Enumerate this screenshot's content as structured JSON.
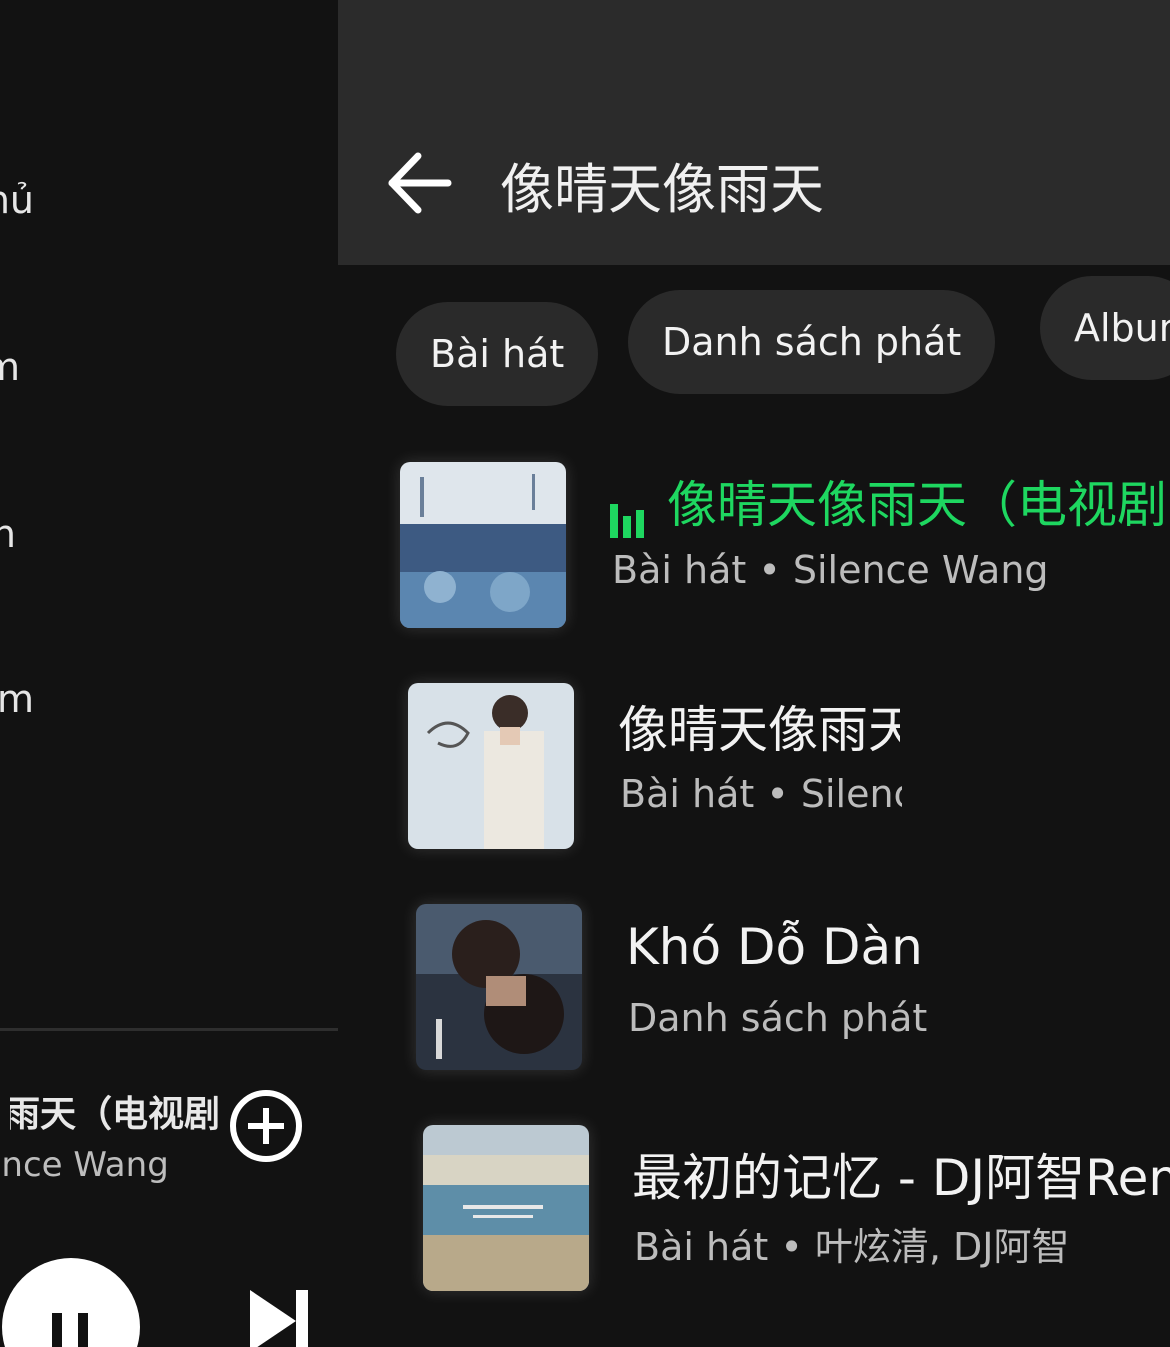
{
  "sidebar": {
    "items": [
      {
        "label": "Trang chủ"
      },
      {
        "label": "Tìm kiếm"
      },
      {
        "label": "Thư viện"
      },
      {
        "label": "Premium"
      }
    ]
  },
  "now_playing": {
    "title": "像晴天像雨天（电视剧《",
    "artist": "Silence Wang"
  },
  "search": {
    "query": "像晴天像雨天"
  },
  "filters": [
    "Bài hát",
    "Danh sách phát",
    "Album"
  ],
  "results": [
    {
      "title": "像晴天像雨天（电视剧",
      "subtitle": "Bài hát • Silence Wang",
      "playing": true
    },
    {
      "title": "像晴天像雨天",
      "subtitle": "Bài hát • Silence Wang",
      "playing": false
    },
    {
      "title": "Khó Dỗ Dàn",
      "subtitle": "Danh sách phát",
      "playing": false
    },
    {
      "title": "最初的记忆 - DJ阿智Remix",
      "subtitle": "Bài hát • 叶炫清, DJ阿智",
      "playing": false
    }
  ],
  "colors": {
    "accent": "#1ed760",
    "background": "#121212",
    "header": "#2b2b2b",
    "chip": "#2a2a2a"
  },
  "icons": [
    "back-arrow-icon",
    "equalizer-icon",
    "add-circle-icon",
    "pause-icon",
    "skip-next-icon"
  ]
}
